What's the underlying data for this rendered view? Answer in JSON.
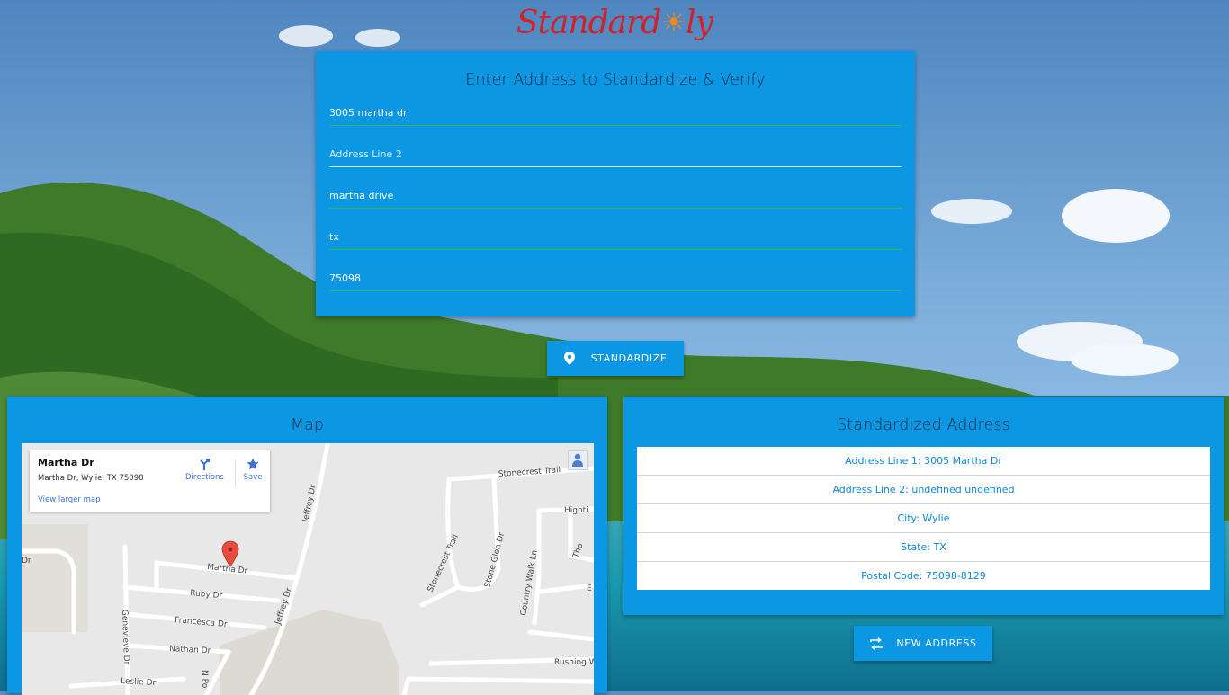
{
  "brand": {
    "logo_left": "Standard",
    "logo_right": "ly",
    "logo_sun": "☀"
  },
  "form": {
    "title": "Enter Address to Standardize & Verify",
    "address_line1": "3005 martha dr",
    "address_line2_placeholder": "Address Line 2",
    "city": "martha drive",
    "state": "tx",
    "postal_code": "75098"
  },
  "actions": {
    "standardize_label": "STANDARDIZE",
    "new_address_label": "NEW ADDRESS"
  },
  "map_panel": {
    "title": "Map",
    "card_name": "Martha Dr",
    "card_address": "Martha Dr, Wylie, TX 75098",
    "directions_label": "Directions",
    "save_label": "Save",
    "larger_map_label": "View larger map",
    "road_labels": {
      "martha": "Martha Dr",
      "ruby": "Ruby Dr",
      "francesca": "Francesca Dr",
      "nathan": "Nathan Dr",
      "leslie": "Leslie Dr",
      "genevieve": "Genevieve Dr",
      "jeffrey_top": "Jeffrey Dr",
      "jeffrey_mid": "Jeffrey Dr",
      "stonecrest_trail_top": "Stonecrest Trail",
      "stonecrest_trail_side": "Stonecrest Trail",
      "stone_glen": "Stone Glen Dr",
      "country_walk": "Country Walk Ln",
      "highting": "Highti",
      "thor": "Tho",
      "rushing": "Rushing W",
      "dr_left": "Dr",
      "e_right": "E",
      "n_po": "N Po"
    }
  },
  "result_panel": {
    "title": "Standardized Address",
    "rows": [
      "Address Line 1: 3005 Martha Dr",
      "Address Line 2: undefined undefined",
      "City: Wylie",
      "State: TX",
      "Postal Code: 75098-8129"
    ]
  },
  "colors": {
    "panel": "#0b97e4",
    "accent_green": "#39b54a",
    "logo_red": "#d0222a",
    "logo_orange": "#f08a1c",
    "marker_red": "#e74c3c"
  }
}
